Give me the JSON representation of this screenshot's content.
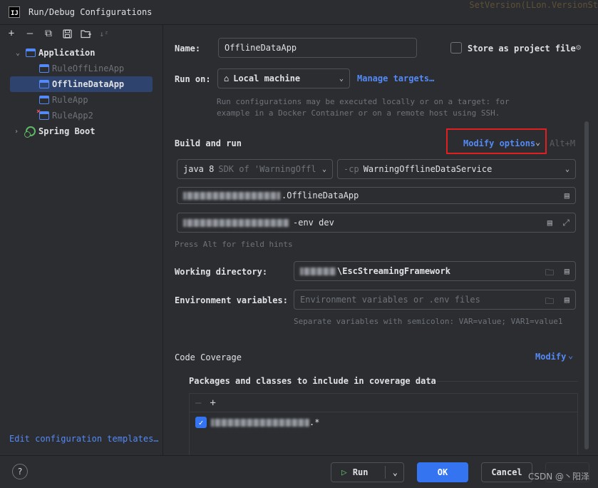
{
  "window": {
    "title": "Run/Debug Configurations",
    "app_icon_text": "IJ",
    "background_code_snippet": "SetVersion(LLon.VersionSt"
  },
  "toolbar": {
    "icons": [
      "plus-icon",
      "minus-icon",
      "copy-icon",
      "save-icon",
      "folder-add-icon",
      "sort-icon"
    ]
  },
  "tree": {
    "application": {
      "label": "Application",
      "items": [
        {
          "label": "RuleOffLineApp",
          "selected": false,
          "error": false
        },
        {
          "label": "OfflineDataApp",
          "selected": true,
          "error": false
        },
        {
          "label": "RuleApp",
          "selected": false,
          "error": false
        },
        {
          "label": "RuleApp2",
          "selected": false,
          "error": true
        }
      ]
    },
    "spring_boot": {
      "label": "Spring Boot"
    }
  },
  "edit_templates_link": "Edit configuration templates…",
  "form": {
    "name_label": "Name:",
    "name_value": "OfflineDataApp",
    "store_label": "Store as project file",
    "store_checked": false,
    "run_on_label": "Run on:",
    "run_on_value": "Local machine",
    "manage_targets": "Manage targets…",
    "run_on_hint_line1": "Run configurations may be executed locally or on a target: for",
    "run_on_hint_line2": "example in a Docker Container or on a remote host using SSH.",
    "build_run_title": "Build and run",
    "modify_options": "Modify options",
    "modify_shortcut": "Alt+M",
    "jdk_value": "java 8",
    "jdk_hint": "SDK of 'WarningOffl",
    "cp_prefix": "-cp",
    "cp_value": "WarningOfflineDataService",
    "main_class_suffix": ".OfflineDataApp",
    "program_args_suffix": "-env dev",
    "field_hints": "Press Alt for field hints",
    "workdir_label": "Working directory:",
    "workdir_suffix": "\\EscStreamingFramework",
    "env_label": "Environment variables:",
    "env_placeholder": "Environment variables or .env files",
    "env_hint": "Separate variables with semicolon: VAR=value; VAR1=value1",
    "coverage_title": "Code Coverage",
    "coverage_modify": "Modify",
    "coverage_packages": "Packages and classes to include in coverage data",
    "coverage_item_suffix": ".*",
    "coverage_item_checked": true
  },
  "buttons": {
    "help": "?",
    "run": "Run",
    "ok": "OK",
    "cancel": "Cancel"
  },
  "watermark": "CSDN @丶阳泽",
  "colors": {
    "accent": "#3574f0",
    "link": "#548af7",
    "selection": "#2e436e",
    "highlight": "#e02020",
    "background": "#2b2d30"
  }
}
